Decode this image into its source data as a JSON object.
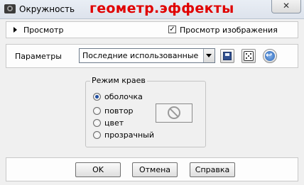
{
  "window": {
    "title": "Окружность",
    "overlay_text": "геометр.эффекты",
    "close_label": "✕"
  },
  "preview": {
    "label": "Просмотр",
    "image_preview_label": "Просмотр изображения",
    "image_preview_checked": true,
    "check_mark": "✓"
  },
  "params": {
    "label": "Параметры",
    "selected": "Последние использованные"
  },
  "edge_mode": {
    "legend": "Режим краев",
    "options": [
      "оболочка",
      "повтор",
      "цвет",
      "прозрачный"
    ],
    "selected_index": 0
  },
  "buttons": {
    "ok": "OK",
    "cancel": "Отмена",
    "help": "Справка"
  },
  "colors": {
    "overlay_red": "#e00000",
    "accent_blue": "#1e4da0"
  }
}
